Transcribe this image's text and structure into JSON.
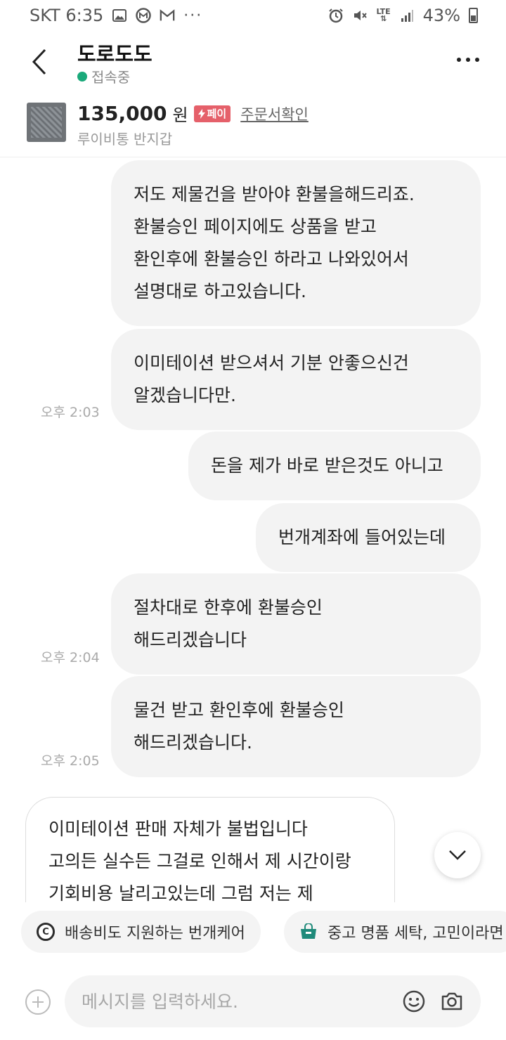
{
  "status_bar": {
    "carrier_time": "SKT 6:35",
    "icons_left": [
      "image-icon",
      "m-circle-icon",
      "gmail-icon",
      "more-dots"
    ],
    "dots": "···",
    "lte": "LTE",
    "battery": "43%"
  },
  "header": {
    "title": "도로도도",
    "status": "접속중",
    "more": "⋯"
  },
  "product": {
    "price": "135,000",
    "currency": "원",
    "pay_badge": "페이",
    "order_link": "주문서확인",
    "name": "루이비통 반지갑"
  },
  "messages": [
    {
      "side": "right",
      "lines": [
        "저도 제물건을 받아야 환불을해드리죠.",
        "환불승인 페이지에도 상품을 받고",
        "환인후에 환불승인 하라고 나와있어서",
        "설명대로 하고있습니다."
      ]
    },
    {
      "side": "right",
      "lines": [
        "이미테이션 받으셔서 기분 안좋으신건",
        "알겠습니다만."
      ],
      "time": "오후 2:03"
    },
    {
      "side": "right",
      "lines": [
        "돈을 제가 바로 받은것도 아니고"
      ]
    },
    {
      "side": "right",
      "lines": [
        "번개계좌에 들어있는데"
      ]
    },
    {
      "side": "right",
      "lines": [
        "절차대로 한후에 환불승인",
        "해드리겠습니다"
      ],
      "time": "오후 2:04"
    },
    {
      "side": "right",
      "lines": [
        "물건 받고 환인후에 환불승인",
        "해드리겠습니다."
      ],
      "time": "오후 2:05"
    },
    {
      "side": "left",
      "lines": [
        "이미테이션 판매 자체가 불법입니다",
        "고의든 실수든 그걸로 인해서 제 시간이랑",
        "기회비용 날리고있는데 그럼 저는 제"
      ]
    }
  ],
  "suggestions": [
    {
      "label": "배송비도 지원하는 번개케어",
      "icon": "c-circle-icon"
    },
    {
      "label": "중고 명품 세탁, 고민이라면",
      "icon": "shopping-bag-icon"
    }
  ],
  "input": {
    "placeholder": "메시지를 입력하세요."
  }
}
